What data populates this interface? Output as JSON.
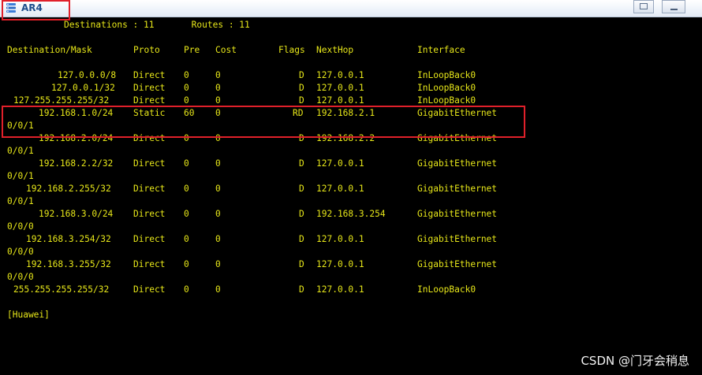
{
  "window": {
    "title": "AR4"
  },
  "summary": {
    "destinations_label": "Destinations : 11",
    "routes_label": "Routes : 11"
  },
  "table": {
    "headers": [
      "Destination/Mask",
      "Proto",
      "Pre",
      "Cost",
      "Flags",
      "NextHop",
      "Interface"
    ],
    "rows": [
      {
        "dest": "127.0.0.0/8",
        "proto": "Direct",
        "pre": "0",
        "cost": "0",
        "flags": "D",
        "nexthop": "127.0.0.1",
        "iface": "InLoopBack0",
        "iface_cont": ""
      },
      {
        "dest": "127.0.0.1/32",
        "proto": "Direct",
        "pre": "0",
        "cost": "0",
        "flags": "D",
        "nexthop": "127.0.0.1",
        "iface": "InLoopBack0",
        "iface_cont": ""
      },
      {
        "dest": "127.255.255.255/32",
        "proto": "Direct",
        "pre": "0",
        "cost": "0",
        "flags": "D",
        "nexthop": "127.0.0.1",
        "iface": "InLoopBack0",
        "iface_cont": ""
      },
      {
        "dest": "192.168.1.0/24",
        "proto": "Static",
        "pre": "60",
        "cost": "0",
        "flags": "RD",
        "nexthop": "192.168.2.1",
        "iface": "GigabitEthernet",
        "iface_cont": "0/0/1",
        "highlighted": true
      },
      {
        "dest": "192.168.2.0/24",
        "proto": "Direct",
        "pre": "0",
        "cost": "0",
        "flags": "D",
        "nexthop": "192.168.2.2",
        "iface": "GigabitEthernet",
        "iface_cont": "0/0/1"
      },
      {
        "dest": "192.168.2.2/32",
        "proto": "Direct",
        "pre": "0",
        "cost": "0",
        "flags": "D",
        "nexthop": "127.0.0.1",
        "iface": "GigabitEthernet",
        "iface_cont": "0/0/1"
      },
      {
        "dest": "192.168.2.255/32",
        "proto": "Direct",
        "pre": "0",
        "cost": "0",
        "flags": "D",
        "nexthop": "127.0.0.1",
        "iface": "GigabitEthernet",
        "iface_cont": "0/0/1"
      },
      {
        "dest": "192.168.3.0/24",
        "proto": "Direct",
        "pre": "0",
        "cost": "0",
        "flags": "D",
        "nexthop": "192.168.3.254",
        "iface": "GigabitEthernet",
        "iface_cont": "0/0/0"
      },
      {
        "dest": "192.168.3.254/32",
        "proto": "Direct",
        "pre": "0",
        "cost": "0",
        "flags": "D",
        "nexthop": "127.0.0.1",
        "iface": "GigabitEthernet",
        "iface_cont": "0/0/0"
      },
      {
        "dest": "192.168.3.255/32",
        "proto": "Direct",
        "pre": "0",
        "cost": "0",
        "flags": "D",
        "nexthop": "127.0.0.1",
        "iface": "GigabitEthernet",
        "iface_cont": "0/0/0"
      },
      {
        "dest": "255.255.255.255/32",
        "proto": "Direct",
        "pre": "0",
        "cost": "0",
        "flags": "D",
        "nexthop": "127.0.0.1",
        "iface": "InLoopBack0",
        "iface_cont": ""
      }
    ]
  },
  "prompt": "[Huawei]",
  "watermark": "CSDN @门牙会稍息",
  "colors": {
    "terminal_bg": "#000000",
    "terminal_text": "#e6e619",
    "highlight_border": "#e0202a"
  }
}
